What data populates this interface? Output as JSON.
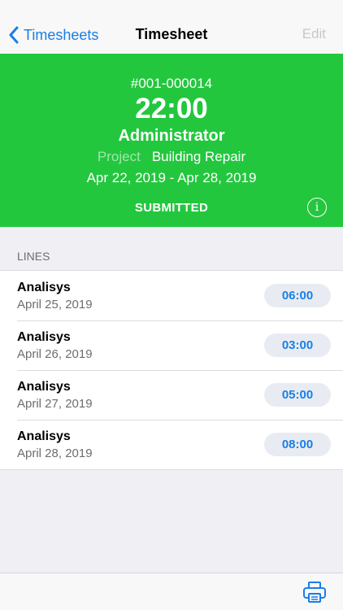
{
  "nav": {
    "back_label": "Timesheets",
    "title": "Timesheet",
    "edit_label": "Edit"
  },
  "header": {
    "number": "#001-000014",
    "total_hours": "22:00",
    "user": "Administrator",
    "project_label": "Project",
    "project_value": "Building Repair",
    "date_range": "Apr 22, 2019 - Apr 28, 2019",
    "status": "SUBMITTED",
    "info_icon": "info-icon",
    "background_color": "#23c73e"
  },
  "lines_section": {
    "title": "LINES",
    "items": [
      {
        "name": "Analisys",
        "date": "April 25, 2019",
        "hours": "06:00"
      },
      {
        "name": "Analisys",
        "date": "April 26, 2019",
        "hours": "03:00"
      },
      {
        "name": "Analisys",
        "date": "April 27, 2019",
        "hours": "05:00"
      },
      {
        "name": "Analisys",
        "date": "April 28, 2019",
        "hours": "08:00"
      }
    ]
  },
  "toolbar": {
    "print_icon": "printer-icon",
    "accent_color": "#1a7ee6"
  }
}
